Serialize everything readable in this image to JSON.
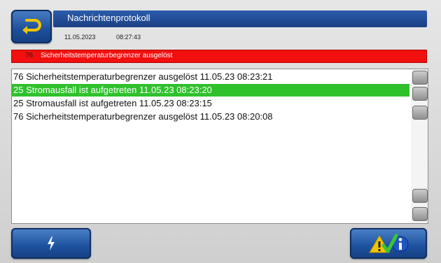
{
  "header": {
    "title": "Nachrichtenprotokoll",
    "date": "11.05.2023",
    "time": "08:27:43"
  },
  "alarm": {
    "code": "76",
    "text": "Sicherheitstemperaturbegrenzer ausgelöst",
    "color": "#f20f0f"
  },
  "messages": [
    {
      "text": "76 Sicherheitstemperaturbegrenzer ausgelöst 11.05.23 08:23:21",
      "selected": false
    },
    {
      "text": "25 Stromausfall ist aufgetreten 11.05.23 08:23:20",
      "selected": true
    },
    {
      "text": "25 Stromausfall ist aufgetreten 11.05.23 08:23:15",
      "selected": false
    },
    {
      "text": "76 Sicherheitstemperaturbegrenzer ausgelöst 11.05.23 08:20:08",
      "selected": false
    }
  ],
  "icons": {
    "back": "back-arrow-icon",
    "left_button": "lightning-icon",
    "right_button": "warning-check-info-icon"
  },
  "colors": {
    "selected_row": "#2fc12c",
    "title_bar": "#1b3f84",
    "button": "#1d519e"
  }
}
